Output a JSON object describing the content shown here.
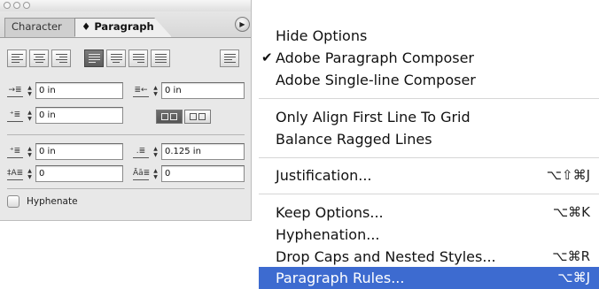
{
  "palette": {
    "tabs": [
      "Character",
      "♦ Paragraph"
    ],
    "left_indent": "0 in",
    "right_indent": "0 in",
    "first_line_indent": "0 in",
    "space_before": "0 in",
    "space_after": "0.125 in",
    "drop_cap_lines": "0",
    "drop_cap_chars": "0",
    "hyphenate_label": "Hyphenate",
    "hyphenate_checked": false
  },
  "menu": {
    "group1": [
      {
        "label": "Hide Options",
        "shortcut": "",
        "checked": false
      },
      {
        "label": "Adobe Paragraph Composer",
        "shortcut": "",
        "checked": true
      },
      {
        "label": "Adobe Single-line Composer",
        "shortcut": "",
        "checked": false
      }
    ],
    "group2": [
      {
        "label": "Only Align First Line To Grid",
        "shortcut": ""
      },
      {
        "label": "Balance Ragged Lines",
        "shortcut": ""
      }
    ],
    "group3": [
      {
        "label": "Justification...",
        "shortcut": "⌥⇧⌘J"
      }
    ],
    "group4": [
      {
        "label": "Keep Options...",
        "shortcut": "⌥⌘K"
      },
      {
        "label": "Hyphenation...",
        "shortcut": ""
      },
      {
        "label": "Drop Caps and Nested Styles...",
        "shortcut": "⌥⌘R"
      },
      {
        "label": "Paragraph Rules...",
        "shortcut": "⌥⌘J",
        "selected": true
      }
    ],
    "check_glyph": "✔"
  },
  "colors": {
    "selection": "#3d6bd0"
  }
}
